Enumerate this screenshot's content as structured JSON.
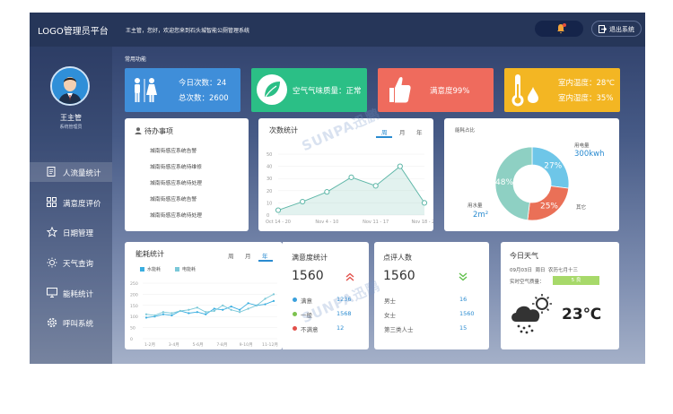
{
  "header": {
    "logo": "LOGO管理员平台",
    "welcome": "王主管，您好，欢迎您来到石头城智能公厕管理系统",
    "logout_label": "退出系统"
  },
  "user": {
    "name": "王主管",
    "role": "系统管理员"
  },
  "nav": [
    {
      "label": "人流量统计",
      "icon": "document-icon",
      "active": true
    },
    {
      "label": "满意度评价",
      "icon": "grid-icon",
      "active": false
    },
    {
      "label": "日期管理",
      "icon": "star-icon",
      "active": false
    },
    {
      "label": "天气查询",
      "icon": "sun-icon",
      "active": false
    },
    {
      "label": "能耗统计",
      "icon": "monitor-icon",
      "active": false
    },
    {
      "label": "呼叫系统",
      "icon": "gear-icon",
      "active": false
    }
  ],
  "section_label": "常用功能",
  "stats": {
    "today_label": "今日次数：",
    "today_value": "24",
    "total_label": "总次数：",
    "total_value": "2600",
    "air_quality": "空气气味质量：正常",
    "satisfaction": "满意度99%",
    "indoor_temp": "室内温度：28℃",
    "indoor_humidity": "室内湿度：35%",
    "colors": {
      "blue": "#3f8ed9",
      "green": "#2bbf86",
      "red": "#ef6b5d",
      "yellow": "#f3b623"
    }
  },
  "todo": {
    "title": "待办事项",
    "items": [
      "城南街感应系统告警",
      "城南街感应系统待维修",
      "城南街感应系统待处理",
      "城南街感应系统告警",
      "城南街感应系统待处理"
    ]
  },
  "count_chart": {
    "title": "次数统计",
    "tabs": [
      "周",
      "月",
      "年"
    ],
    "active_tab": "周",
    "chart_data": {
      "type": "area",
      "x": [
        "Oct 14 - 20",
        "Nov 4 - 10",
        "Nov 11 - 17",
        "Nov 18 - 24"
      ],
      "values": [
        4,
        11,
        19,
        31,
        24,
        40,
        10
      ],
      "ylim": [
        0,
        50
      ],
      "yticks": [
        "50",
        "40",
        "30",
        "20",
        "10",
        "0"
      ],
      "color": "#5fb7a8"
    }
  },
  "energy_ratio": {
    "title": "能耗占比",
    "electric_label": "用电量",
    "electric_value": "300kwh",
    "water_label": "用水量",
    "water_value": "2m²",
    "other_label": "其它",
    "chart_data": {
      "type": "pie",
      "labels": [
        "用电量",
        "其它",
        "用水量"
      ],
      "values": [
        27,
        25,
        48
      ],
      "colors": [
        "#6ec6e8",
        "#ea7057",
        "#8ed0c3"
      ]
    }
  },
  "energy_stats": {
    "title": "能耗统计",
    "tabs": [
      "周",
      "月",
      "年"
    ],
    "active_tab": "年",
    "legend": [
      "水能耗",
      "电能耗"
    ],
    "chart_data": {
      "type": "line",
      "categories": [
        "1-2月",
        "3-4月",
        "5-6月",
        "7-8月",
        "9-10月",
        "11-12月"
      ],
      "yticks": [
        "250",
        "200",
        "150",
        "100",
        "50",
        "0"
      ],
      "ylim": [
        0,
        250
      ],
      "series": [
        {
          "name": "水能耗",
          "color": "#3aaee0",
          "values": [
            95,
            100,
            110,
            105,
            125,
            115,
            120,
            110,
            135,
            130,
            145,
            130,
            160,
            150,
            155,
            170
          ]
        },
        {
          "name": "电能耗",
          "color": "#7ac8d8",
          "values": [
            110,
            105,
            120,
            115,
            125,
            130,
            140,
            120,
            125,
            150,
            130,
            120,
            135,
            150,
            180,
            200
          ]
        }
      ]
    }
  },
  "satisfaction_stats": {
    "title": "满意度统计",
    "total": "1560",
    "rows": [
      {
        "label": "满意",
        "value": "1236",
        "color": "#3aa0dc"
      },
      {
        "label": "一般",
        "value": "1568",
        "color": "#7cc24e"
      },
      {
        "label": "不满意",
        "value": "12",
        "color": "#e2504a"
      }
    ]
  },
  "reviews": {
    "title": "点评人数",
    "total": "1560",
    "rows": [
      {
        "label": "男士",
        "value": "16"
      },
      {
        "label": "女士",
        "value": "1560"
      },
      {
        "label": "第三类人士",
        "value": "15"
      }
    ]
  },
  "weather": {
    "title": "今日天气",
    "date": "09月03日",
    "weekday": "周日",
    "lunar": "农历七月十三",
    "aqi_label": "实时空气质量：",
    "aqi_value": "5 良",
    "temperature": "23℃"
  },
  "watermark": "SUNPA迅鹏"
}
